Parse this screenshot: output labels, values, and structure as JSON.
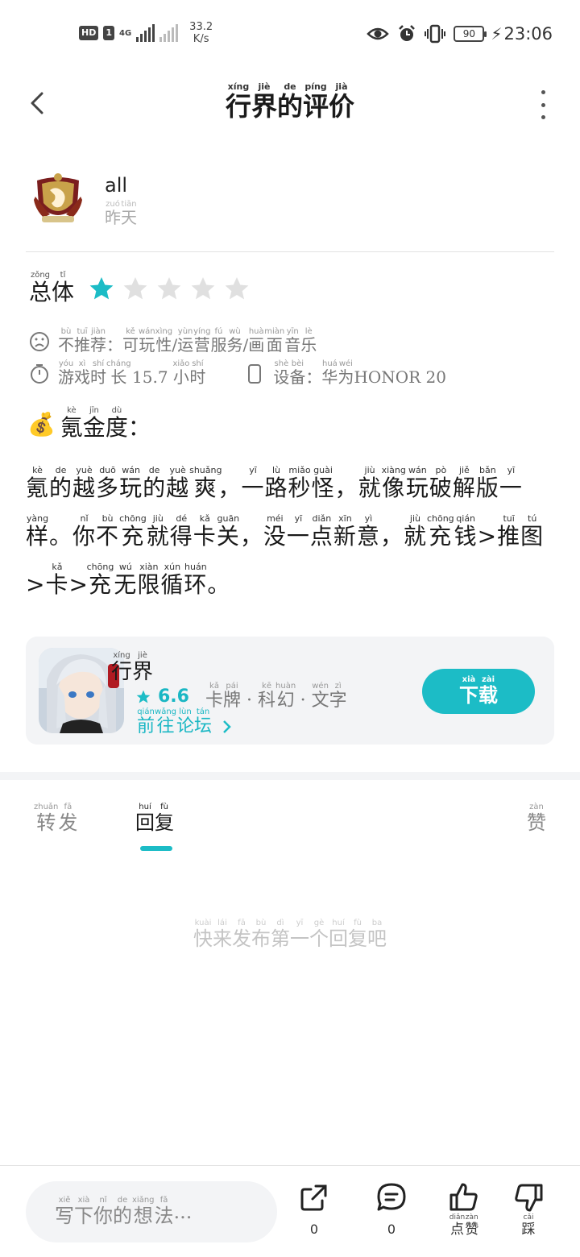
{
  "status_bar": {
    "hd_badge": "HD",
    "sim_badge": "1",
    "network": "4G",
    "speed_value": "33.2",
    "speed_unit": "K/s",
    "battery": "90",
    "time": "23:06"
  },
  "header": {
    "title": [
      {
        "c": "行",
        "p": "xíng"
      },
      {
        "c": "界",
        "p": "jiè"
      },
      {
        "c": "的",
        "p": "de"
      },
      {
        "c": "评",
        "p": "píng"
      },
      {
        "c": "价",
        "p": "jià"
      }
    ]
  },
  "user": {
    "name": "all",
    "date": [
      {
        "c": "昨",
        "p": "zuó"
      },
      {
        "c": "天",
        "p": "tiān"
      }
    ]
  },
  "rating": {
    "label": [
      {
        "c": "总",
        "p": "zǒng"
      },
      {
        "c": "体",
        "p": "tǐ"
      }
    ],
    "stars": 1,
    "max_stars": 5,
    "star_on_color": "#1cbcc6",
    "star_off_color": "#e0e0e0"
  },
  "meta": {
    "not_recommend": [
      {
        "c": "不",
        "p": "bù"
      },
      {
        "c": "推",
        "p": "tuī"
      },
      {
        "c": "荐",
        "p": "jiàn"
      },
      {
        "c": "：",
        "p": ""
      },
      {
        "c": "可",
        "p": "kě"
      },
      {
        "c": "玩",
        "p": "wán"
      },
      {
        "c": "性",
        "p": "xìng"
      },
      {
        "c": "/",
        "p": ""
      },
      {
        "c": "运",
        "p": "yùn"
      },
      {
        "c": "营",
        "p": "yíng"
      },
      {
        "c": "服",
        "p": "fú"
      },
      {
        "c": "务",
        "p": "wù"
      },
      {
        "c": "/",
        "p": ""
      },
      {
        "c": "画",
        "p": "huà"
      },
      {
        "c": "面",
        "p": "miàn"
      },
      {
        "c": "音",
        "p": "yīn"
      },
      {
        "c": "乐",
        "p": "lè"
      }
    ],
    "playtime": [
      {
        "c": "游",
        "p": "yóu"
      },
      {
        "c": "戏",
        "p": "xì"
      },
      {
        "c": "时",
        "p": "shí"
      },
      {
        "c": "长",
        "p": "cháng"
      },
      {
        "c": " 15.7 ",
        "p": ""
      },
      {
        "c": "小",
        "p": "xiǎo"
      },
      {
        "c": "时",
        "p": "shí"
      }
    ],
    "device": [
      {
        "c": "设",
        "p": "shè"
      },
      {
        "c": "备",
        "p": "bèi"
      },
      {
        "c": "：",
        "p": ""
      },
      {
        "c": "华",
        "p": "huá"
      },
      {
        "c": "为",
        "p": "wéi"
      },
      {
        "c": "HONOR 20",
        "p": ""
      }
    ]
  },
  "review": {
    "section_emoji": "💰",
    "section_title": [
      {
        "c": "氪",
        "p": "kè"
      },
      {
        "c": "金",
        "p": "jīn"
      },
      {
        "c": "度",
        "p": "dù"
      },
      {
        "c": "：",
        "p": ""
      }
    ],
    "body": [
      {
        "c": "氪",
        "p": "kè"
      },
      {
        "c": "的",
        "p": "de"
      },
      {
        "c": "越",
        "p": "yuè"
      },
      {
        "c": "多",
        "p": "duō"
      },
      {
        "c": "玩",
        "p": "wán"
      },
      {
        "c": "的",
        "p": "de"
      },
      {
        "c": "越",
        "p": "yuè"
      },
      {
        "c": "爽",
        "p": "shuǎng"
      },
      {
        "c": "，",
        "p": ""
      },
      {
        "c": "一",
        "p": "yī"
      },
      {
        "c": "路",
        "p": "lù"
      },
      {
        "c": "秒",
        "p": "miǎo"
      },
      {
        "c": "怪",
        "p": "guài"
      },
      {
        "c": "，",
        "p": ""
      },
      {
        "c": "就",
        "p": "jiù"
      },
      {
        "c": "像",
        "p": "xiàng"
      },
      {
        "c": "玩",
        "p": "wán"
      },
      {
        "c": "破",
        "p": "pò"
      },
      {
        "c": "解",
        "p": "jiě"
      },
      {
        "c": "版",
        "p": "bǎn"
      },
      {
        "c": "一",
        "p": "yī"
      },
      {
        "c": "样",
        "p": "yàng"
      },
      {
        "c": "。",
        "p": ""
      },
      {
        "c": "你",
        "p": "nǐ"
      },
      {
        "c": "不",
        "p": "bù"
      },
      {
        "c": "充",
        "p": "chōng"
      },
      {
        "c": "就",
        "p": "jiù"
      },
      {
        "c": "得",
        "p": "dé"
      },
      {
        "c": "卡",
        "p": "kǎ"
      },
      {
        "c": "关",
        "p": "guān"
      },
      {
        "c": "，",
        "p": ""
      },
      {
        "c": "没",
        "p": "méi"
      },
      {
        "c": "一",
        "p": "yī"
      },
      {
        "c": "点",
        "p": "diǎn"
      },
      {
        "c": "新",
        "p": "xīn"
      },
      {
        "c": "意",
        "p": "yì"
      },
      {
        "c": "，",
        "p": ""
      },
      {
        "c": "就",
        "p": "jiù"
      },
      {
        "c": "充",
        "p": "chōng"
      },
      {
        "c": "钱",
        "p": "qián"
      },
      {
        "c": ">",
        "p": ""
      },
      {
        "c": "推",
        "p": "tuī"
      },
      {
        "c": "图",
        "p": "tú"
      },
      {
        "c": ">",
        "p": ""
      },
      {
        "c": "卡",
        "p": "kǎ"
      },
      {
        "c": ">",
        "p": ""
      },
      {
        "c": "充",
        "p": "chōng"
      },
      {
        "c": "无",
        "p": "wú"
      },
      {
        "c": "限",
        "p": "xiàn"
      },
      {
        "c": "循",
        "p": "xún"
      },
      {
        "c": "环",
        "p": "huán"
      },
      {
        "c": "。",
        "p": ""
      }
    ]
  },
  "game": {
    "name": [
      {
        "c": "行",
        "p": "xíng"
      },
      {
        "c": "界",
        "p": "jiè"
      }
    ],
    "score": "6.6",
    "tags": [
      {
        "c": "卡",
        "p": "kǎ"
      },
      {
        "c": "牌",
        "p": "pái"
      },
      {
        "c": " · ",
        "p": ""
      },
      {
        "c": "科",
        "p": "kē"
      },
      {
        "c": "幻",
        "p": "huàn"
      },
      {
        "c": " · ",
        "p": ""
      },
      {
        "c": "文",
        "p": "wén"
      },
      {
        "c": "字",
        "p": "zì"
      }
    ],
    "forum_link": [
      {
        "c": "前",
        "p": "qián"
      },
      {
        "c": "往",
        "p": "wǎng"
      },
      {
        "c": "论",
        "p": "lùn"
      },
      {
        "c": "坛",
        "p": "tán"
      }
    ],
    "download": [
      {
        "c": "下",
        "p": "xià"
      },
      {
        "c": "载",
        "p": "zài"
      }
    ],
    "accent_color": "#1cbcc6"
  },
  "tabs": {
    "forward": [
      {
        "c": "转",
        "p": "zhuǎn"
      },
      {
        "c": "发",
        "p": "fā"
      }
    ],
    "reply": [
      {
        "c": "回",
        "p": "huí"
      },
      {
        "c": "复",
        "p": "fù"
      }
    ],
    "like": [
      {
        "c": "赞",
        "p": "zàn"
      }
    ]
  },
  "empty_hint": [
    {
      "c": "快",
      "p": "kuài"
    },
    {
      "c": "来",
      "p": "lái"
    },
    {
      "c": "发",
      "p": "fā"
    },
    {
      "c": "布",
      "p": "bù"
    },
    {
      "c": "第",
      "p": "dì"
    },
    {
      "c": "一",
      "p": "yī"
    },
    {
      "c": "个",
      "p": "gè"
    },
    {
      "c": "回",
      "p": "huí"
    },
    {
      "c": "复",
      "p": "fù"
    },
    {
      "c": "吧",
      "p": "ba"
    }
  ],
  "bottom_bar": {
    "placeholder": [
      {
        "c": "写",
        "p": "xiě"
      },
      {
        "c": "下",
        "p": "xià"
      },
      {
        "c": "你",
        "p": "nǐ"
      },
      {
        "c": "的",
        "p": "de"
      },
      {
        "c": "想",
        "p": "xiǎng"
      },
      {
        "c": "法",
        "p": "fǎ"
      },
      {
        "c": "...",
        "p": ""
      }
    ],
    "share_count": "0",
    "comment_count": "0",
    "like_label": [
      {
        "c": "点",
        "p": "diǎn"
      },
      {
        "c": "赞",
        "p": "zàn"
      }
    ],
    "dislike_label": [
      {
        "c": "踩",
        "p": "cǎi"
      }
    ]
  },
  "icons": {
    "back": "chevron-left-icon",
    "more": "more-vertical-icon",
    "sad_face": "sad-face-icon",
    "timer": "stopwatch-icon",
    "device": "phone-icon",
    "share": "share-icon",
    "comment": "comment-icon",
    "like": "thumbs-up-icon",
    "dislike": "thumbs-down-icon"
  }
}
